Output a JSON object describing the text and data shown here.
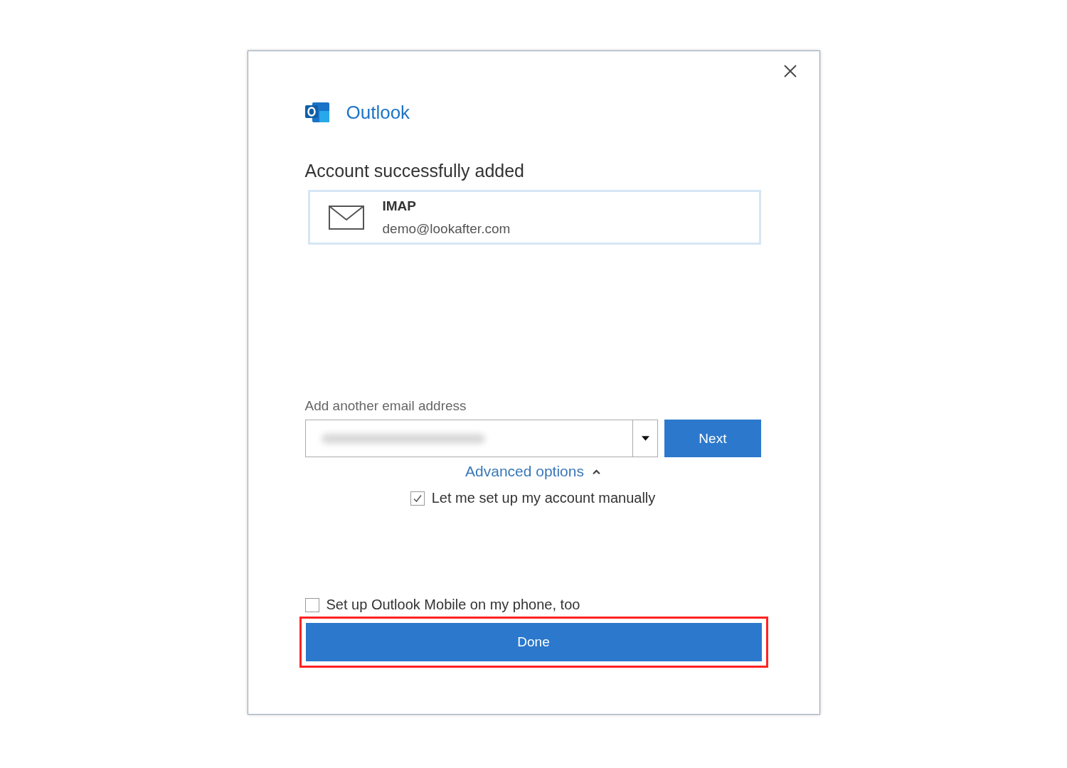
{
  "app": {
    "name": "Outlook"
  },
  "heading": "Account successfully added",
  "account": {
    "type": "IMAP",
    "email": "demo@lookafter.com"
  },
  "add_email": {
    "label": "Add another email address",
    "value_redacted": true,
    "next_button": "Next"
  },
  "advanced_options": {
    "label": "Advanced options",
    "expanded": true
  },
  "options": [
    {
      "label": "Let me set up my account manually",
      "checked": true
    }
  ],
  "mobile_option": {
    "label": "Set up Outlook Mobile on my phone, too",
    "checked": false
  },
  "done_button": {
    "label": "Done",
    "highlighted": true
  }
}
